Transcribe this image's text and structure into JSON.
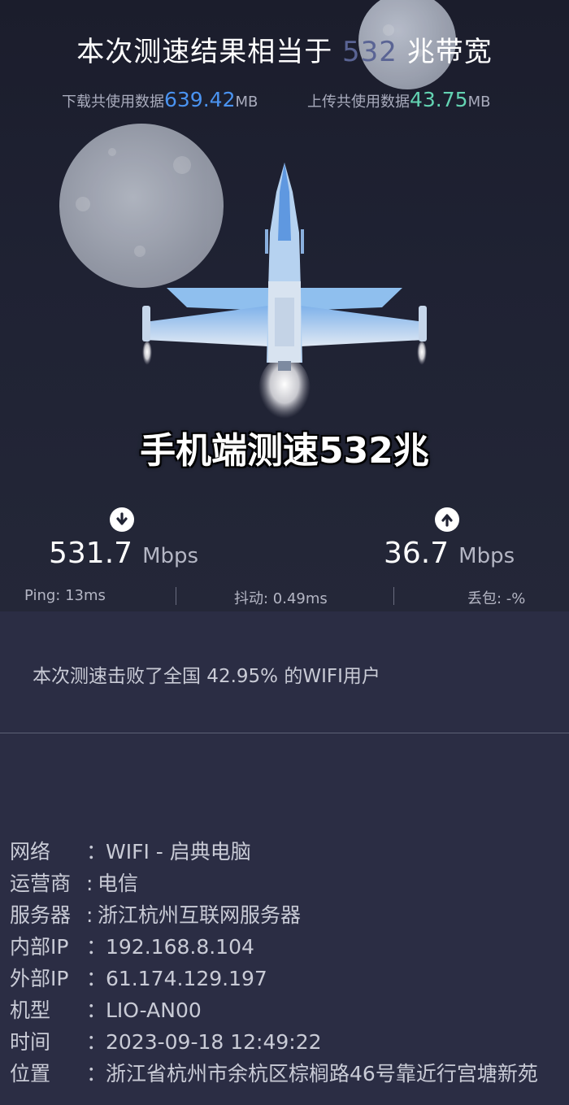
{
  "headline": {
    "prefix": "本次测速结果相当于",
    "number": "532",
    "suffix": "兆带宽"
  },
  "usage": {
    "download_label": "下载共使用数据",
    "download_value": "639.42",
    "download_unit": "MB",
    "upload_label": "上传共使用数据",
    "upload_value": "43.75",
    "upload_unit": "MB"
  },
  "caption": "手机端测速532兆",
  "speeds": {
    "download_value": "531.7",
    "download_unit": "Mbps",
    "upload_value": "36.7",
    "upload_unit": "Mbps"
  },
  "stats": {
    "ping": "Ping:  13ms",
    "jitter": "抖动:  0.49ms",
    "loss": "丢包:  -%"
  },
  "beat_text": "本次测速击败了全国 42.95% 的WIFI用户",
  "info": [
    {
      "label": "网络",
      "sep": "：",
      "value": "WIFI - 启典电脑"
    },
    {
      "label": "运营商",
      "sep": ":",
      "value": "电信"
    },
    {
      "label": "服务器",
      "sep": ":",
      "value": "浙江杭州互联网服务器"
    },
    {
      "label": "内部IP",
      "sep": "：",
      "value": "192.168.8.104"
    },
    {
      "label": "外部IP",
      "sep": "：",
      "value": "61.174.129.197"
    },
    {
      "label": "机型",
      "sep": "：",
      "value": "LIO-AN00"
    },
    {
      "label": "时间",
      "sep": "：",
      "value": "2023-09-18 12:49:22"
    },
    {
      "label": "位置",
      "sep": "：",
      "value": "浙江省杭州市余杭区棕榈路46号靠近行宫塘新苑"
    }
  ],
  "icons": {
    "download": "arrow-down-circle-icon",
    "upload": "arrow-up-circle-icon"
  },
  "colors": {
    "download_accent": "#4a93f0",
    "upload_accent": "#63d3b2",
    "headline_number": "#5a6494"
  }
}
